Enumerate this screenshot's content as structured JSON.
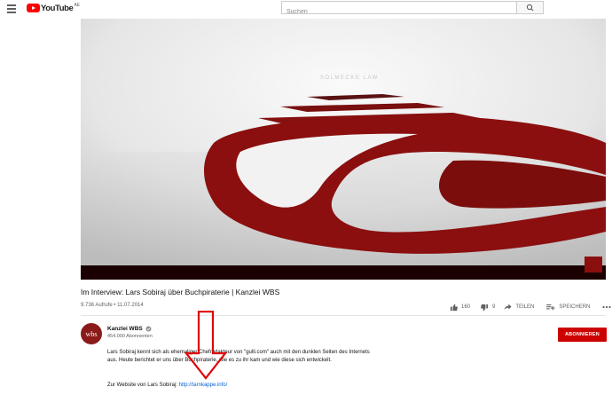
{
  "header": {
    "logo_text": "YouTube",
    "logo_region": "AE",
    "search_placeholder": "Suchen"
  },
  "video": {
    "title": "Im Interview: Lars Sobiraj über Buchpiraterie | Kanzlei WBS",
    "views_date": "9.736 Aufrufe • 11.07.2014"
  },
  "actions": {
    "likes": "160",
    "dislikes": "9",
    "share_label": "TEILEN",
    "save_label": "SPEICHERN"
  },
  "channel": {
    "avatar_text": "wbs",
    "name": "Kanzlei WBS",
    "subscribers": "454.000 Abonnenten",
    "subscribe_label": "ABONNIEREN"
  },
  "description": {
    "text": "Lars Sobiraj kennt sich als ehemaliger Chefredakteur von \"gulli.com\" auch mit den dunklen Seiten des Internets aus. Heute berichtet er uns über Buchpiraterie, wie es zu ihr kam und wie diese sich entwickelt.",
    "link_prefix": "Zur Website von Lars Sobiraj: ",
    "link_text": "http://tarnkappe.info/"
  },
  "colors": {
    "brand_red": "#ff0000",
    "subscribe_red": "#cc0000",
    "link_blue": "#065fd4",
    "annotation_arrow": "#e00000",
    "video_logo_red": "#8b0f0f"
  },
  "icons": {
    "menu": "hamburger-icon",
    "search": "search-icon",
    "like": "thumbs-up-icon",
    "dislike": "thumbs-down-icon",
    "share": "share-icon",
    "save": "playlist-add-icon",
    "more": "more-icon",
    "verified": "verified-check-icon"
  }
}
